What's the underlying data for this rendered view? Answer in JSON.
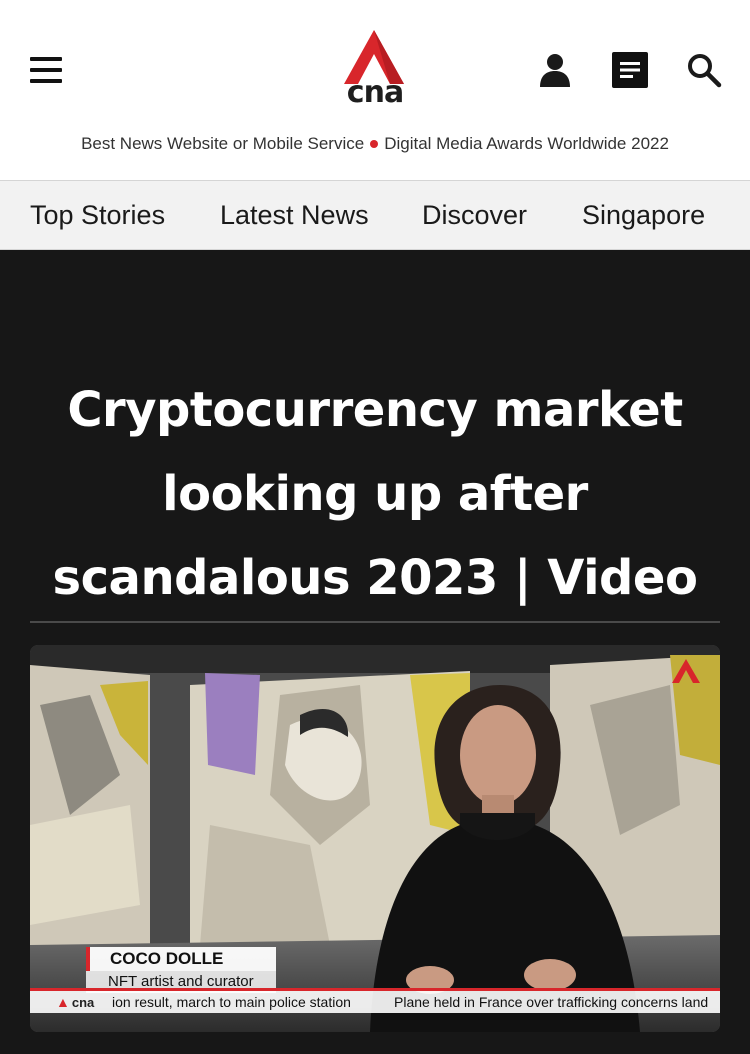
{
  "header": {
    "logo_text": "cna",
    "award_left": "Best News Website or Mobile Service",
    "award_right": "Digital Media Awards Worldwide 2022",
    "brand_color": "#d8262b",
    "icons": [
      "menu-icon",
      "user-icon",
      "article-list-icon",
      "search-icon"
    ]
  },
  "nav": {
    "items": [
      {
        "label": "Top Stories"
      },
      {
        "label": "Latest News"
      },
      {
        "label": "Discover"
      },
      {
        "label": "Singapore"
      }
    ]
  },
  "article": {
    "title_line1": "Cryptocurrency market",
    "title_line2": "looking up after",
    "title_line3": "scandalous 2023 | Video"
  },
  "video": {
    "speaker_name": "COCO DOLLE",
    "speaker_role": "NFT artist and curator",
    "ticker_logo": "cna",
    "ticker_left": "ion result, march to main police station",
    "ticker_right": "Plane held in France over trafficking concerns land"
  }
}
